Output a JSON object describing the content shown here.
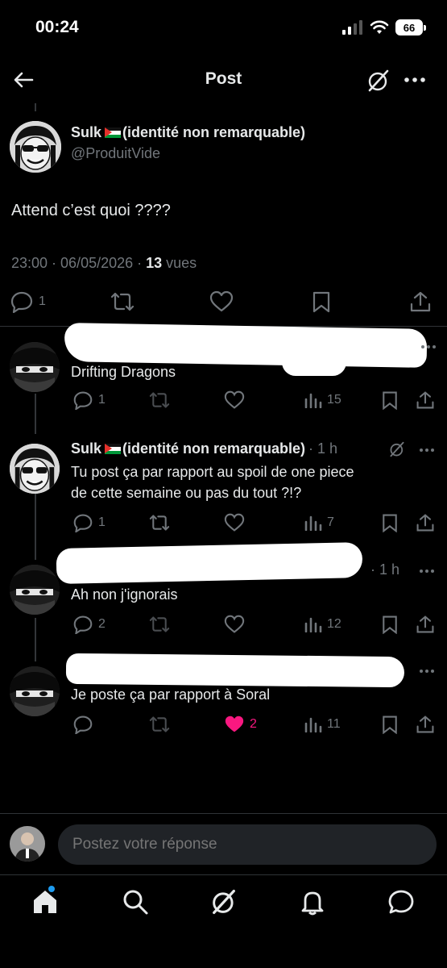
{
  "status_bar": {
    "time": "00:24",
    "battery": "66"
  },
  "header": {
    "title": "Post"
  },
  "main_post": {
    "display_name": "Sulk",
    "name_suffix": "(identité non remarquable)",
    "handle": "@ProduitVide",
    "text": "Attend c’est quoi ????",
    "timestamp": "23:00 · 06/05/2026 · ",
    "views_count": "13",
    "views_label": " vues",
    "replies": "1"
  },
  "replies": [
    {
      "text": "Drifting Dragons",
      "replies": "1",
      "retweets": "",
      "likes": "",
      "views": "15"
    },
    {
      "display_name": "Sulk",
      "name_suffix": "(identité non remarquable)",
      "time": "· 1 h",
      "text_line1": "Tu post ça par rapport au spoil de one piece",
      "text_line2": "de cette semaine ou pas du tout ?!?",
      "replies": "1",
      "views": "7"
    },
    {
      "partial_meta": "...",
      "time": "· 1 h",
      "text": "Ah non j'ignorais",
      "replies": "2",
      "views": "12"
    },
    {
      "text": "Je poste ça par rapport à Soral",
      "likes": "2",
      "views": "11",
      "like_color": "#f91880"
    }
  ],
  "compose": {
    "placeholder": "Postez votre réponse"
  },
  "colors": {
    "accent": "#1d9bf0",
    "like": "#f91880",
    "muted": "#71767b"
  }
}
